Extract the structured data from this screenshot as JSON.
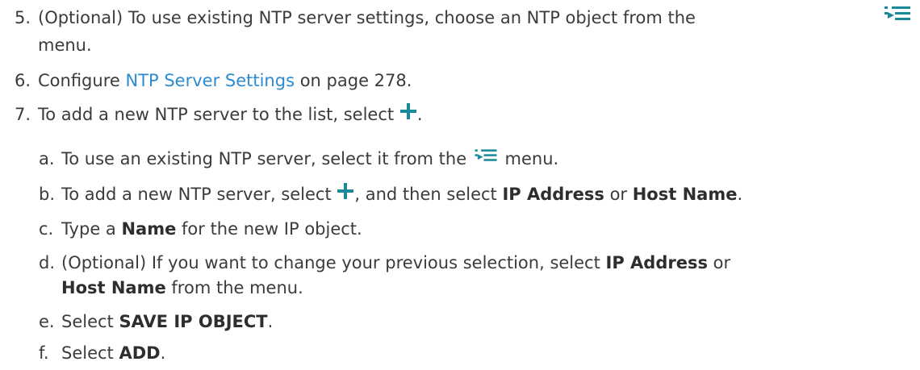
{
  "steps": [
    {
      "num": "5.",
      "parts": {
        "a": "(Optional) To use existing NTP server settings, choose an NTP object from the",
        "b": "menu."
      },
      "icons": [
        "menu-list-icon"
      ]
    },
    {
      "num": "6.",
      "parts": {
        "a": "Configure ",
        "link": "NTP Server Settings",
        "b": " on page 278."
      }
    },
    {
      "num": "7.",
      "parts": {
        "a": "To add a new NTP server to the list, select ",
        "b": "."
      },
      "icons": [
        "add-plus-icon"
      ]
    }
  ],
  "substeps": [
    {
      "letter": "a.",
      "parts": {
        "a": "To use an existing NTP server, select it from the ",
        "b": " menu."
      },
      "icons": [
        "menu-list-icon"
      ]
    },
    {
      "letter": "b.",
      "parts": {
        "a": "To add a new NTP server, select ",
        "b": ", and then select ",
        "bold1": "IP Address",
        "c": " or ",
        "bold2": "Host Name",
        "d": "."
      },
      "icons": [
        "add-plus-icon"
      ]
    },
    {
      "letter": "c.",
      "parts": {
        "a": "Type a ",
        "bold1": "Name",
        "b": " for the new IP object."
      }
    },
    {
      "letter": "d.",
      "parts": {
        "a": "(Optional) If you want to change your previous selection, select ",
        "bold1": "IP Address",
        "b": " or",
        "bold2": "Host Name",
        "c": " from the menu."
      }
    },
    {
      "letter": "e.",
      "parts": {
        "a": "Select ",
        "bold1": "SAVE IP OBJECT",
        "b": "."
      }
    },
    {
      "letter": "f.",
      "parts": {
        "a": "Select ",
        "bold1": "ADD",
        "b": "."
      }
    }
  ],
  "colors": {
    "text": "#3b3b3b",
    "link": "#2d8bd0",
    "icon_teal": "#1a8a9a"
  }
}
